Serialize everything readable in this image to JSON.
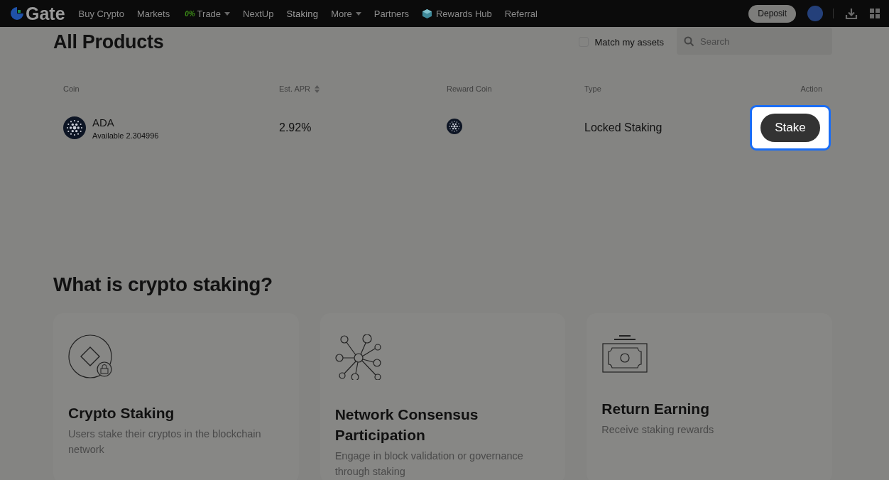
{
  "nav": {
    "logo": "Gate",
    "items": [
      {
        "label": "Buy Crypto",
        "kind": "link",
        "selected": false
      },
      {
        "label": "Markets",
        "kind": "link",
        "selected": false
      },
      {
        "label": "Trade",
        "kind": "dropdown",
        "badge": "0%",
        "selected": false
      },
      {
        "label": "NextUp",
        "kind": "link",
        "selected": false
      },
      {
        "label": "Staking",
        "kind": "link",
        "selected": true
      },
      {
        "label": "More",
        "kind": "dropdown",
        "selected": false
      },
      {
        "label": "Partners",
        "kind": "link",
        "selected": false
      },
      {
        "label": "Rewards Hub",
        "kind": "icon-link",
        "selected": false
      },
      {
        "label": "Referral",
        "kind": "link",
        "selected": false
      }
    ],
    "deposit": "Deposit"
  },
  "products": {
    "title": "All Products",
    "match_assets": {
      "label": "Match my assets",
      "checked": false
    },
    "search": {
      "placeholder": "Search"
    },
    "columns": [
      {
        "label": "Coin",
        "sortable": false
      },
      {
        "label": "Est. APR",
        "sortable": true
      },
      {
        "label": "Reward Coin",
        "sortable": false
      },
      {
        "label": "Type",
        "sortable": false
      },
      {
        "label": "Action",
        "sortable": false
      }
    ],
    "rows": [
      {
        "coin": "ADA",
        "available": "Available 2.304996",
        "apr": "2.92%",
        "type": "Locked Staking",
        "action": "Stake",
        "highlighted": true
      }
    ]
  },
  "staking_info": {
    "title": "What is crypto staking?",
    "cards": [
      {
        "kind": "lock",
        "title": "Crypto Staking",
        "text": "Users stake their cryptos in the blockchain network"
      },
      {
        "kind": "network",
        "title": "Network Consensus Participation",
        "text": "Engage in block validation or governance through staking"
      },
      {
        "kind": "money",
        "title": "Return Earning",
        "text": "Receive staking rewards"
      }
    ]
  }
}
